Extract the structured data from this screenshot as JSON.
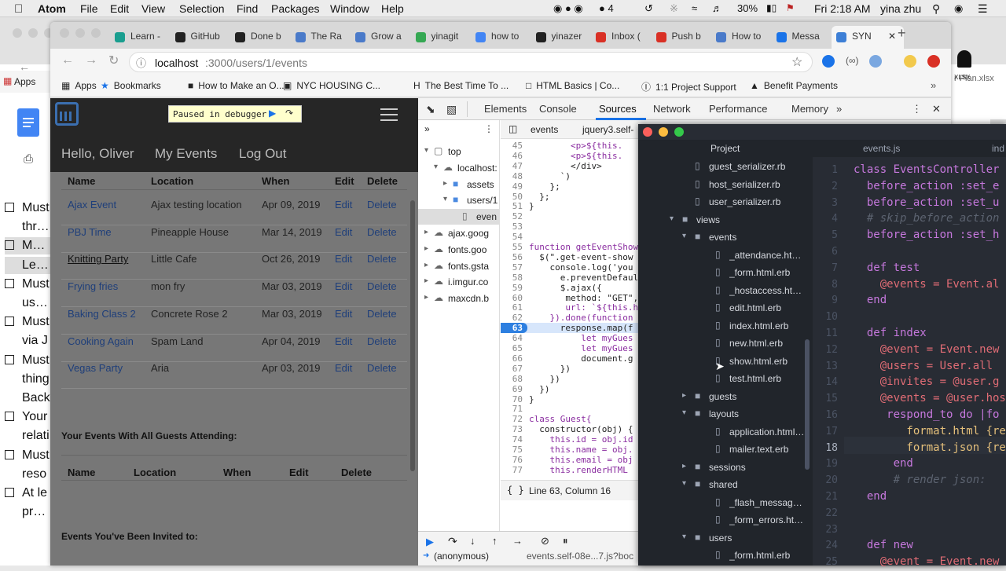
{
  "menubar": {
    "app": "Atom",
    "items": [
      "File",
      "Edit",
      "View",
      "Selection",
      "Find",
      "Packages",
      "Window",
      "Help"
    ],
    "status": {
      "battery": "30%",
      "clock": "Fri 2:18 AM",
      "user": "yina zhu",
      "badge": "4"
    }
  },
  "bg_doc": {
    "checklist": [
      "Must",
      "throu",
      "Make",
      "Let &",
      "Must",
      "using",
      "Must",
      "via J",
      "Must",
      "thing",
      "Back",
      "Your",
      "relati",
      "Must",
      "reso",
      "At le",
      "proto"
    ],
    "right_frag": "r Plan.xlsx",
    "right_tab": "XLSX"
  },
  "browser": {
    "tabs": [
      "Learn -",
      "GitHub",
      "Done b",
      "The Ra",
      "Grow a",
      "yinagit",
      "how to",
      "yinazer",
      "Inbox (",
      "Push b",
      "How to",
      "Messa",
      "SYN"
    ],
    "url_host": "localhost",
    "url_rest": ":3000/users/1/events",
    "bookmarks": [
      "Apps",
      "Bookmarks",
      "How to Make an O...",
      "NYC HOUSING C...",
      "The Best Time To ...",
      "HTML Basics | Co...",
      "1:1 Project Support",
      "Benefit Payments"
    ],
    "bg_bm": "Apps"
  },
  "webpage": {
    "paused": "Paused in debugger",
    "nav": [
      "Hello, Oliver",
      "My Events",
      "Log Out"
    ],
    "headers": [
      "Name",
      "Location",
      "When",
      "Edit",
      "Delete"
    ],
    "rows": [
      {
        "name": "Ajax Event",
        "loc": "Ajax testing location",
        "when": "Apr 09, 2019",
        "edit": "Edit",
        "del": "Delete"
      },
      {
        "name": "PBJ Time",
        "loc": "Pineapple House",
        "when": "Mar 14, 2019",
        "edit": "Edit",
        "del": "Delete"
      },
      {
        "name": "Knitting Party",
        "loc": "Little Cafe",
        "when": "Oct 26, 2019",
        "edit": "Edit",
        "del": "Delete"
      },
      {
        "name": "Frying fries",
        "loc": "mon fry",
        "when": "Mar 03, 2019",
        "edit": "Edit",
        "del": "Delete"
      },
      {
        "name": "Baking Class 2",
        "loc": "Concrete Rose 2",
        "when": "Mar 03, 2019",
        "edit": "Edit",
        "del": "Delete"
      },
      {
        "name": "Cooking Again",
        "loc": "Spam Land",
        "when": "Apr 04, 2019",
        "edit": "Edit",
        "del": "Delete"
      },
      {
        "name": "Vegas Party",
        "loc": "Aria",
        "when": "Apr 03, 2019",
        "edit": "Edit",
        "del": "Delete"
      }
    ],
    "section2": "Your Events With All Guests Attending:",
    "headers2": [
      "Name",
      "Location",
      "When",
      "Edit",
      "Delete"
    ],
    "section3": "Events You've Been Invited to:"
  },
  "devtools": {
    "tabs": [
      "Elements",
      "Console",
      "Sources",
      "Network",
      "Performance",
      "Memory"
    ],
    "tree": [
      "top",
      "localhost:",
      "assets",
      "users/1",
      "even",
      "ajax.goog",
      "fonts.goo",
      "fonts.gsta",
      "i.imgur.co",
      "maxcdn.b"
    ],
    "file_tabs": [
      "events",
      "jquery3.self-"
    ],
    "code": [
      {
        "n": "45",
        "t": "        <p>${this."
      },
      {
        "n": "46",
        "t": "        <p>${this."
      },
      {
        "n": "47",
        "t": "        </div>"
      },
      {
        "n": "48",
        "t": "      `)"
      },
      {
        "n": "49",
        "t": "    };"
      },
      {
        "n": "50",
        "t": "  };"
      },
      {
        "n": "51",
        "t": "}"
      },
      {
        "n": "52",
        "t": ""
      },
      {
        "n": "53",
        "t": ""
      },
      {
        "n": "54",
        "t": ""
      },
      {
        "n": "55",
        "t": "function getEventShow"
      },
      {
        "n": "56",
        "t": "  $(\".get-event-show"
      },
      {
        "n": "57",
        "t": "    console.log('you"
      },
      {
        "n": "58",
        "t": "      e.preventDefaul"
      },
      {
        "n": "59",
        "t": "      $.ajax({"
      },
      {
        "n": "60",
        "t": "       method: \"GET\","
      },
      {
        "n": "61",
        "t": "       url: `${this.h"
      },
      {
        "n": "62",
        "t": "    }).done(function"
      },
      {
        "n": "63",
        "t": "      response.map(f"
      },
      {
        "n": "64",
        "t": "          let myGues"
      },
      {
        "n": "65",
        "t": "          let myGues"
      },
      {
        "n": "66",
        "t": "          document.g"
      },
      {
        "n": "67",
        "t": "      })"
      },
      {
        "n": "68",
        "t": "    })"
      },
      {
        "n": "69",
        "t": "  })"
      },
      {
        "n": "70",
        "t": "}"
      },
      {
        "n": "71",
        "t": ""
      },
      {
        "n": "72",
        "t": "class Guest{"
      },
      {
        "n": "73",
        "t": "  constructor(obj) {"
      },
      {
        "n": "74",
        "t": "    this.id = obj.id"
      },
      {
        "n": "75",
        "t": "    this.name = obj."
      },
      {
        "n": "76",
        "t": "    this.email = obj"
      },
      {
        "n": "77",
        "t": "    this.renderHTML"
      }
    ],
    "status": "Line 63, Column 16",
    "callstack": "(anonymous)",
    "callfile": "events.self-08e...7.js?boc"
  },
  "atom": {
    "panel_title": "Project",
    "editor_tab": "events.js",
    "editor_tab2": "ind",
    "tree": [
      {
        "t": "guest_serializer.rb",
        "k": "file",
        "d": 2
      },
      {
        "t": "host_serializer.rb",
        "k": "file",
        "d": 2
      },
      {
        "t": "user_serializer.rb",
        "k": "file",
        "d": 2
      },
      {
        "t": "views",
        "k": "open",
        "d": 1
      },
      {
        "t": "events",
        "k": "open",
        "d": 2
      },
      {
        "t": "_attendance.html.erb",
        "k": "file",
        "d": 3
      },
      {
        "t": "_form.html.erb",
        "k": "file",
        "d": 3
      },
      {
        "t": "_hostaccess.html.erb",
        "k": "file",
        "d": 3
      },
      {
        "t": "edit.html.erb",
        "k": "file",
        "d": 3
      },
      {
        "t": "index.html.erb",
        "k": "file",
        "d": 3
      },
      {
        "t": "new.html.erb",
        "k": "file",
        "d": 3
      },
      {
        "t": "show.html.erb",
        "k": "file",
        "d": 3
      },
      {
        "t": "test.html.erb",
        "k": "file",
        "d": 3
      },
      {
        "t": "guests",
        "k": "closed",
        "d": 2
      },
      {
        "t": "layouts",
        "k": "open",
        "d": 2
      },
      {
        "t": "application.html.erb",
        "k": "file",
        "d": 3
      },
      {
        "t": "mailer.text.erb",
        "k": "file",
        "d": 3
      },
      {
        "t": "sessions",
        "k": "closed",
        "d": 2
      },
      {
        "t": "shared",
        "k": "open",
        "d": 2
      },
      {
        "t": "_flash_messages.html",
        "k": "file",
        "d": 3
      },
      {
        "t": "_form_errors.html.erb",
        "k": "file",
        "d": 3
      },
      {
        "t": "users",
        "k": "open",
        "d": 2
      },
      {
        "t": "_form.html.erb",
        "k": "file",
        "d": 3
      }
    ],
    "code": [
      {
        "n": "1",
        "t": "class EventsController"
      },
      {
        "n": "2",
        "t": "  before_action :set_e"
      },
      {
        "n": "3",
        "t": "  before_action :set_u"
      },
      {
        "n": "4",
        "t": "  # skip_before_action"
      },
      {
        "n": "5",
        "t": "  before_action :set_h"
      },
      {
        "n": "6",
        "t": ""
      },
      {
        "n": "7",
        "t": "  def test"
      },
      {
        "n": "8",
        "t": "    @events = Event.al"
      },
      {
        "n": "9",
        "t": "  end"
      },
      {
        "n": "10",
        "t": ""
      },
      {
        "n": "11",
        "t": "  def index"
      },
      {
        "n": "12",
        "t": "    @event = Event.new"
      },
      {
        "n": "13",
        "t": "    @users = User.all"
      },
      {
        "n": "14",
        "t": "    @invites = @user.g"
      },
      {
        "n": "15",
        "t": "    @events = @user.hos"
      },
      {
        "n": "16",
        "t": "     respond_to do |fo"
      },
      {
        "n": "17",
        "t": "        format.html {re"
      },
      {
        "n": "18",
        "t": "        format.json {re"
      },
      {
        "n": "19",
        "t": "      end"
      },
      {
        "n": "20",
        "t": "      # render json:"
      },
      {
        "n": "21",
        "t": "  end"
      },
      {
        "n": "22",
        "t": ""
      },
      {
        "n": "23",
        "t": ""
      },
      {
        "n": "24",
        "t": "  def new"
      },
      {
        "n": "25",
        "t": "    @event = Event.new"
      }
    ]
  },
  "colors": {
    "accent": "#1a73e8",
    "atom_bg": "#282c34",
    "comment": "#5c6370",
    "keyword": "#c678dd",
    "ivar": "#e06c75",
    "const": "#e5c07b",
    "symbol": "#56b6c2"
  }
}
